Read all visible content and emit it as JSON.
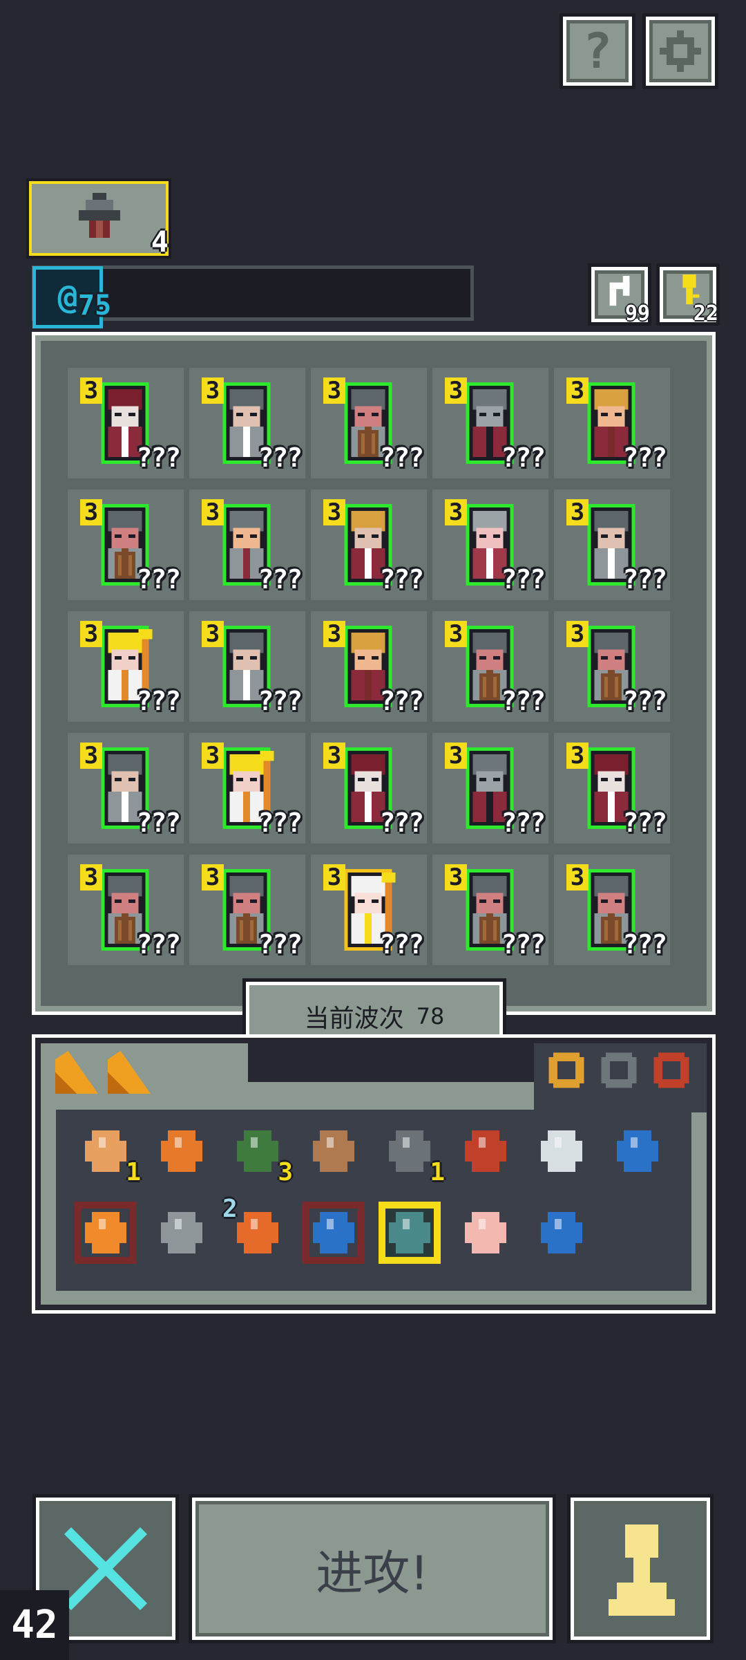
{
  "top": {
    "help_label": "?",
    "settings_icon": "gear-icon"
  },
  "unit_card": {
    "count": "4"
  },
  "mana": {
    "value": "75",
    "icon_text": "@"
  },
  "resources": {
    "refresh_count": "99",
    "key_count": "22"
  },
  "board": {
    "rows": [
      [
        {
          "level": "3",
          "label": "???",
          "kind": "mage",
          "glow": "green"
        },
        {
          "level": "3",
          "label": "???",
          "kind": "knight-sword",
          "glow": "green"
        },
        {
          "level": "3",
          "label": "???",
          "kind": "knight-shield",
          "glow": "green"
        },
        {
          "level": "3",
          "label": "???",
          "kind": "heavy-knight",
          "glow": "green"
        },
        {
          "level": "3",
          "label": "???",
          "kind": "bandit",
          "glow": "green"
        }
      ],
      [
        {
          "level": "3",
          "label": "???",
          "kind": "knight-shield",
          "glow": "green"
        },
        {
          "level": "3",
          "label": "???",
          "kind": "soldier",
          "glow": "green"
        },
        {
          "level": "3",
          "label": "???",
          "kind": "general",
          "glow": "green"
        },
        {
          "level": "3",
          "label": "???",
          "kind": "assassin",
          "glow": "green"
        },
        {
          "level": "3",
          "label": "???",
          "kind": "knight-sword",
          "glow": "green"
        }
      ],
      [
        {
          "level": "3",
          "label": "???",
          "kind": "priest",
          "glow": "green"
        },
        {
          "level": "3",
          "label": "???",
          "kind": "knight-sword",
          "glow": "green"
        },
        {
          "level": "3",
          "label": "???",
          "kind": "bandit",
          "glow": "green"
        },
        {
          "level": "3",
          "label": "???",
          "kind": "knight-shield",
          "glow": "green"
        },
        {
          "level": "3",
          "label": "???",
          "kind": "knight-shield",
          "glow": "green"
        }
      ],
      [
        {
          "level": "3",
          "label": "???",
          "kind": "knight-sword",
          "glow": "green"
        },
        {
          "level": "3",
          "label": "???",
          "kind": "priest",
          "glow": "green"
        },
        {
          "level": "3",
          "label": "???",
          "kind": "mage",
          "glow": "green"
        },
        {
          "level": "3",
          "label": "???",
          "kind": "heavy-knight",
          "glow": "green"
        },
        {
          "level": "3",
          "label": "???",
          "kind": "mage",
          "glow": "green"
        }
      ],
      [
        {
          "level": "3",
          "label": "???",
          "kind": "knight-shield",
          "glow": "green"
        },
        {
          "level": "3",
          "label": "???",
          "kind": "knight-shield",
          "glow": "green"
        },
        {
          "level": "3",
          "label": "???",
          "kind": "angel",
          "glow": "gold"
        },
        {
          "level": "3",
          "label": "???",
          "kind": "knight-shield",
          "glow": "green"
        },
        {
          "level": "3",
          "label": "???",
          "kind": "knight-shield",
          "glow": "green"
        }
      ]
    ]
  },
  "wave": {
    "label": "当前波次",
    "value": "78"
  },
  "inventory": {
    "tabs": [
      "tab-a",
      "tab-b"
    ],
    "relics": [
      "ring-purple-icon",
      "helmet-icon",
      "ring-red-icon"
    ],
    "row1": [
      {
        "icon": "drum-icon",
        "count": "1"
      },
      {
        "icon": "armor-icon",
        "count": ""
      },
      {
        "icon": "goblin-icon",
        "count": "3"
      },
      {
        "icon": "feather-icon",
        "count": ""
      },
      {
        "icon": "crossbow-icon",
        "count": "1"
      },
      {
        "icon": "coral-icon",
        "count": ""
      },
      {
        "icon": "mirror-icon",
        "count": ""
      },
      {
        "icon": "boot-icon",
        "count": ""
      }
    ],
    "row2": [
      {
        "icon": "fire-tile-icon",
        "count": ""
      },
      {
        "icon": "shuriken-icon",
        "count": ""
      },
      {
        "icon": "lightning-scroll-icon",
        "count": "2"
      },
      {
        "icon": "water-tile-icon",
        "count": ""
      },
      {
        "icon": "spikes-icon",
        "count": ""
      },
      {
        "icon": "pig-icon",
        "count": ""
      },
      {
        "icon": "droplet-icon",
        "count": ""
      }
    ]
  },
  "footer": {
    "attack_label": "进攻!",
    "counter": "42"
  },
  "colors": {
    "bg": "#262730",
    "panel": "#5b6865",
    "tile": "#6a7774",
    "accent_green": "#2ee82e",
    "level_yellow": "#f5dd1c",
    "mana_cyan": "#2ab6d6"
  }
}
